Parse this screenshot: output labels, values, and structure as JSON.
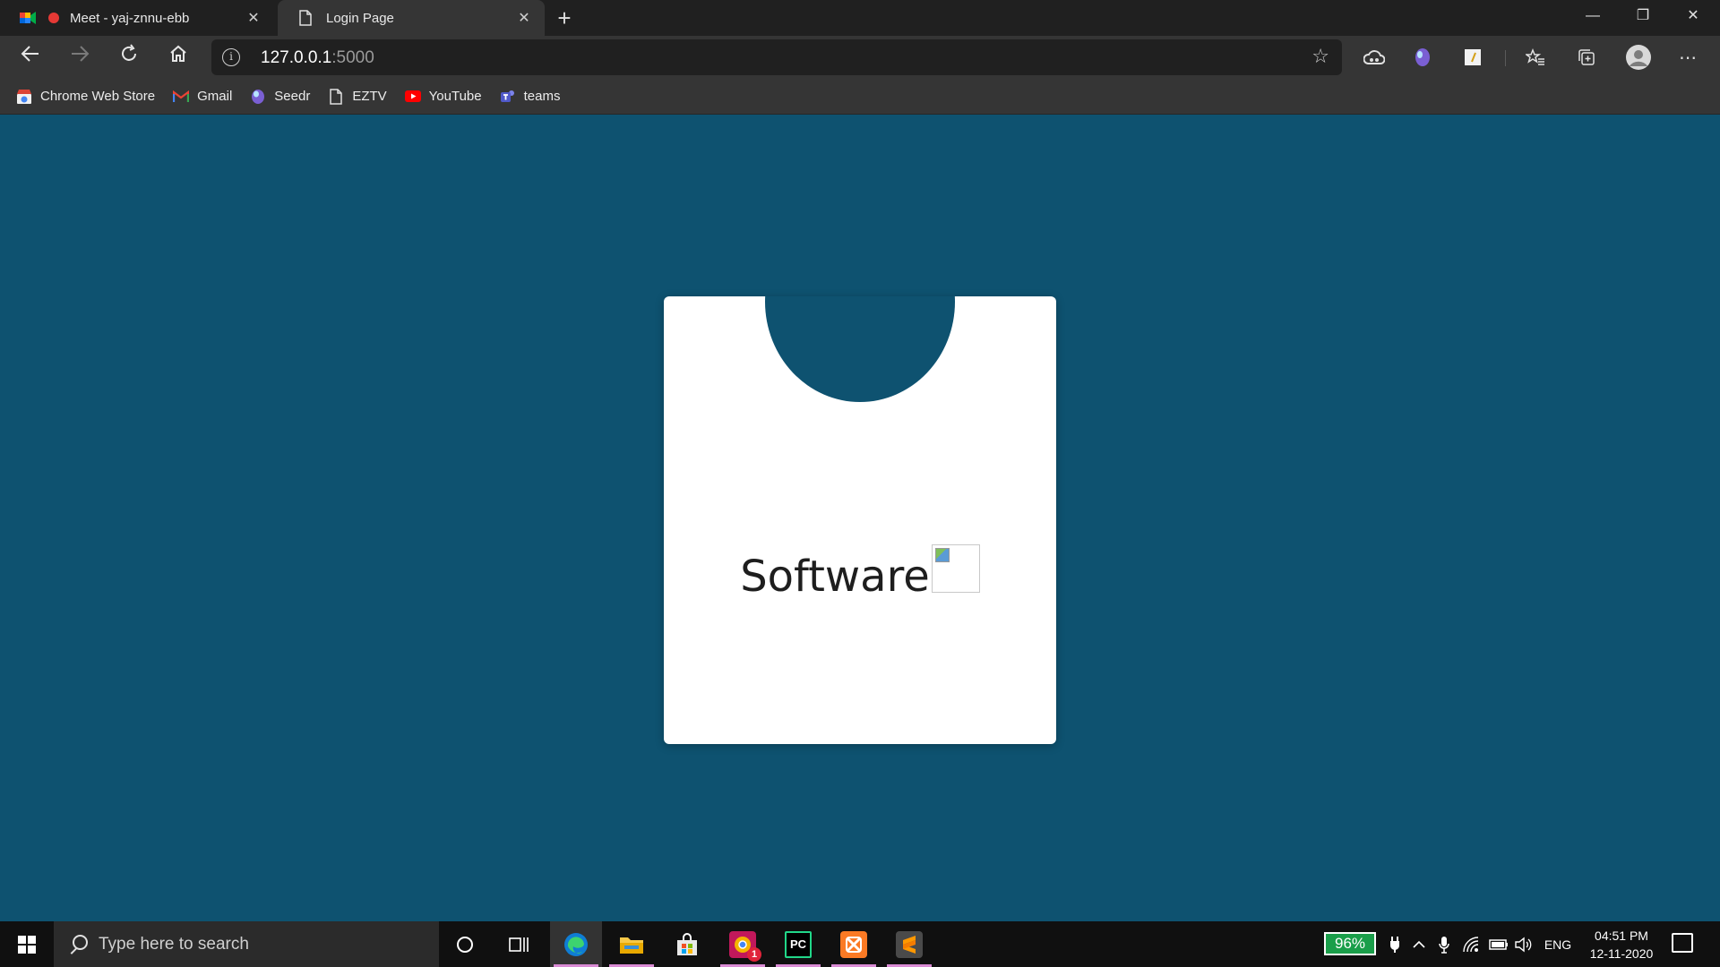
{
  "browser": {
    "tabs": [
      {
        "title": "Meet - yaj-znnu-ebb",
        "close": "✕"
      },
      {
        "title": "Login Page",
        "close": "✕"
      }
    ],
    "new_tab": "+",
    "address": {
      "host": "127.0.0.1",
      "port": ":5000"
    },
    "window_controls": {
      "minimize": "—",
      "restore": "❐",
      "close": "✕"
    }
  },
  "bookmarks": [
    {
      "label": "Chrome Web Store",
      "icon": "chrome-web-store-icon"
    },
    {
      "label": "Gmail",
      "icon": "gmail-icon"
    },
    {
      "label": "Seedr",
      "icon": "seedr-icon"
    },
    {
      "label": "EZTV",
      "icon": "page-icon"
    },
    {
      "label": "YouTube",
      "icon": "youtube-icon"
    },
    {
      "label": "teams",
      "icon": "teams-icon"
    }
  ],
  "page": {
    "brand_text": "Software",
    "card_color": "#ffffff",
    "background_color": "#0e5270"
  },
  "taskbar": {
    "search_placeholder": "Type here to search",
    "battery_percent": "96%",
    "language": "ENG",
    "time": "04:51 PM",
    "date": "12-11-2020",
    "notification_badge": "1",
    "pinned_apps": [
      "edge",
      "file-explorer",
      "microsoft-store",
      "chrome-canary",
      "pycharm",
      "xampp",
      "sublime-text"
    ]
  }
}
